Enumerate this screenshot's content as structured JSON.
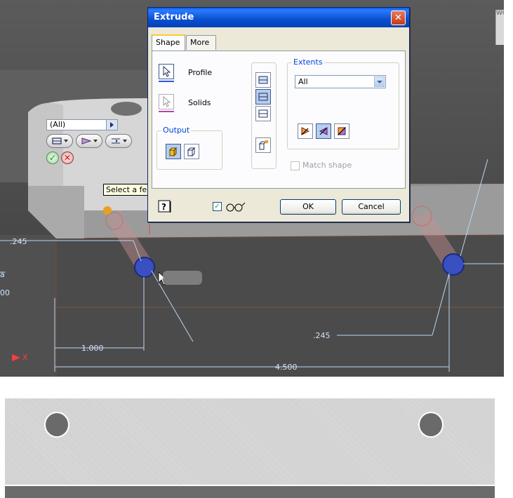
{
  "dialog": {
    "title": "Extrude",
    "close_icon": "close-icon",
    "tabs": [
      {
        "label": "Shape",
        "active": true
      },
      {
        "label": "More",
        "active": false
      }
    ],
    "profile_label": "Profile",
    "solids_label": "Solids",
    "output_title": "Output",
    "extents_title": "Extents",
    "extents_value": "All",
    "match_shape_label": "Match shape",
    "match_shape_checked": false,
    "preview_checked": true,
    "ok_label": "OK",
    "cancel_label": "Cancel",
    "help_icon": "help-icon"
  },
  "mini_toolbar": {
    "combo_value": "(All)"
  },
  "tooltip": "Select a feature or dimension",
  "dimensions": {
    "d1": ".245",
    "d2": ".245",
    "d3": "1.000",
    "d4": "4.500",
    "edge_a": "a",
    "edge_b": "00"
  },
  "axis_label": "X",
  "viewcube_text": "WO",
  "colors": {
    "dialog_title_bar": "#0a4fd0",
    "accent_blue": "#0046d5",
    "dimension_text": "#cfe3ff",
    "axis_red": "#ff3b3b",
    "hole_selection": "#3a4fc0"
  }
}
